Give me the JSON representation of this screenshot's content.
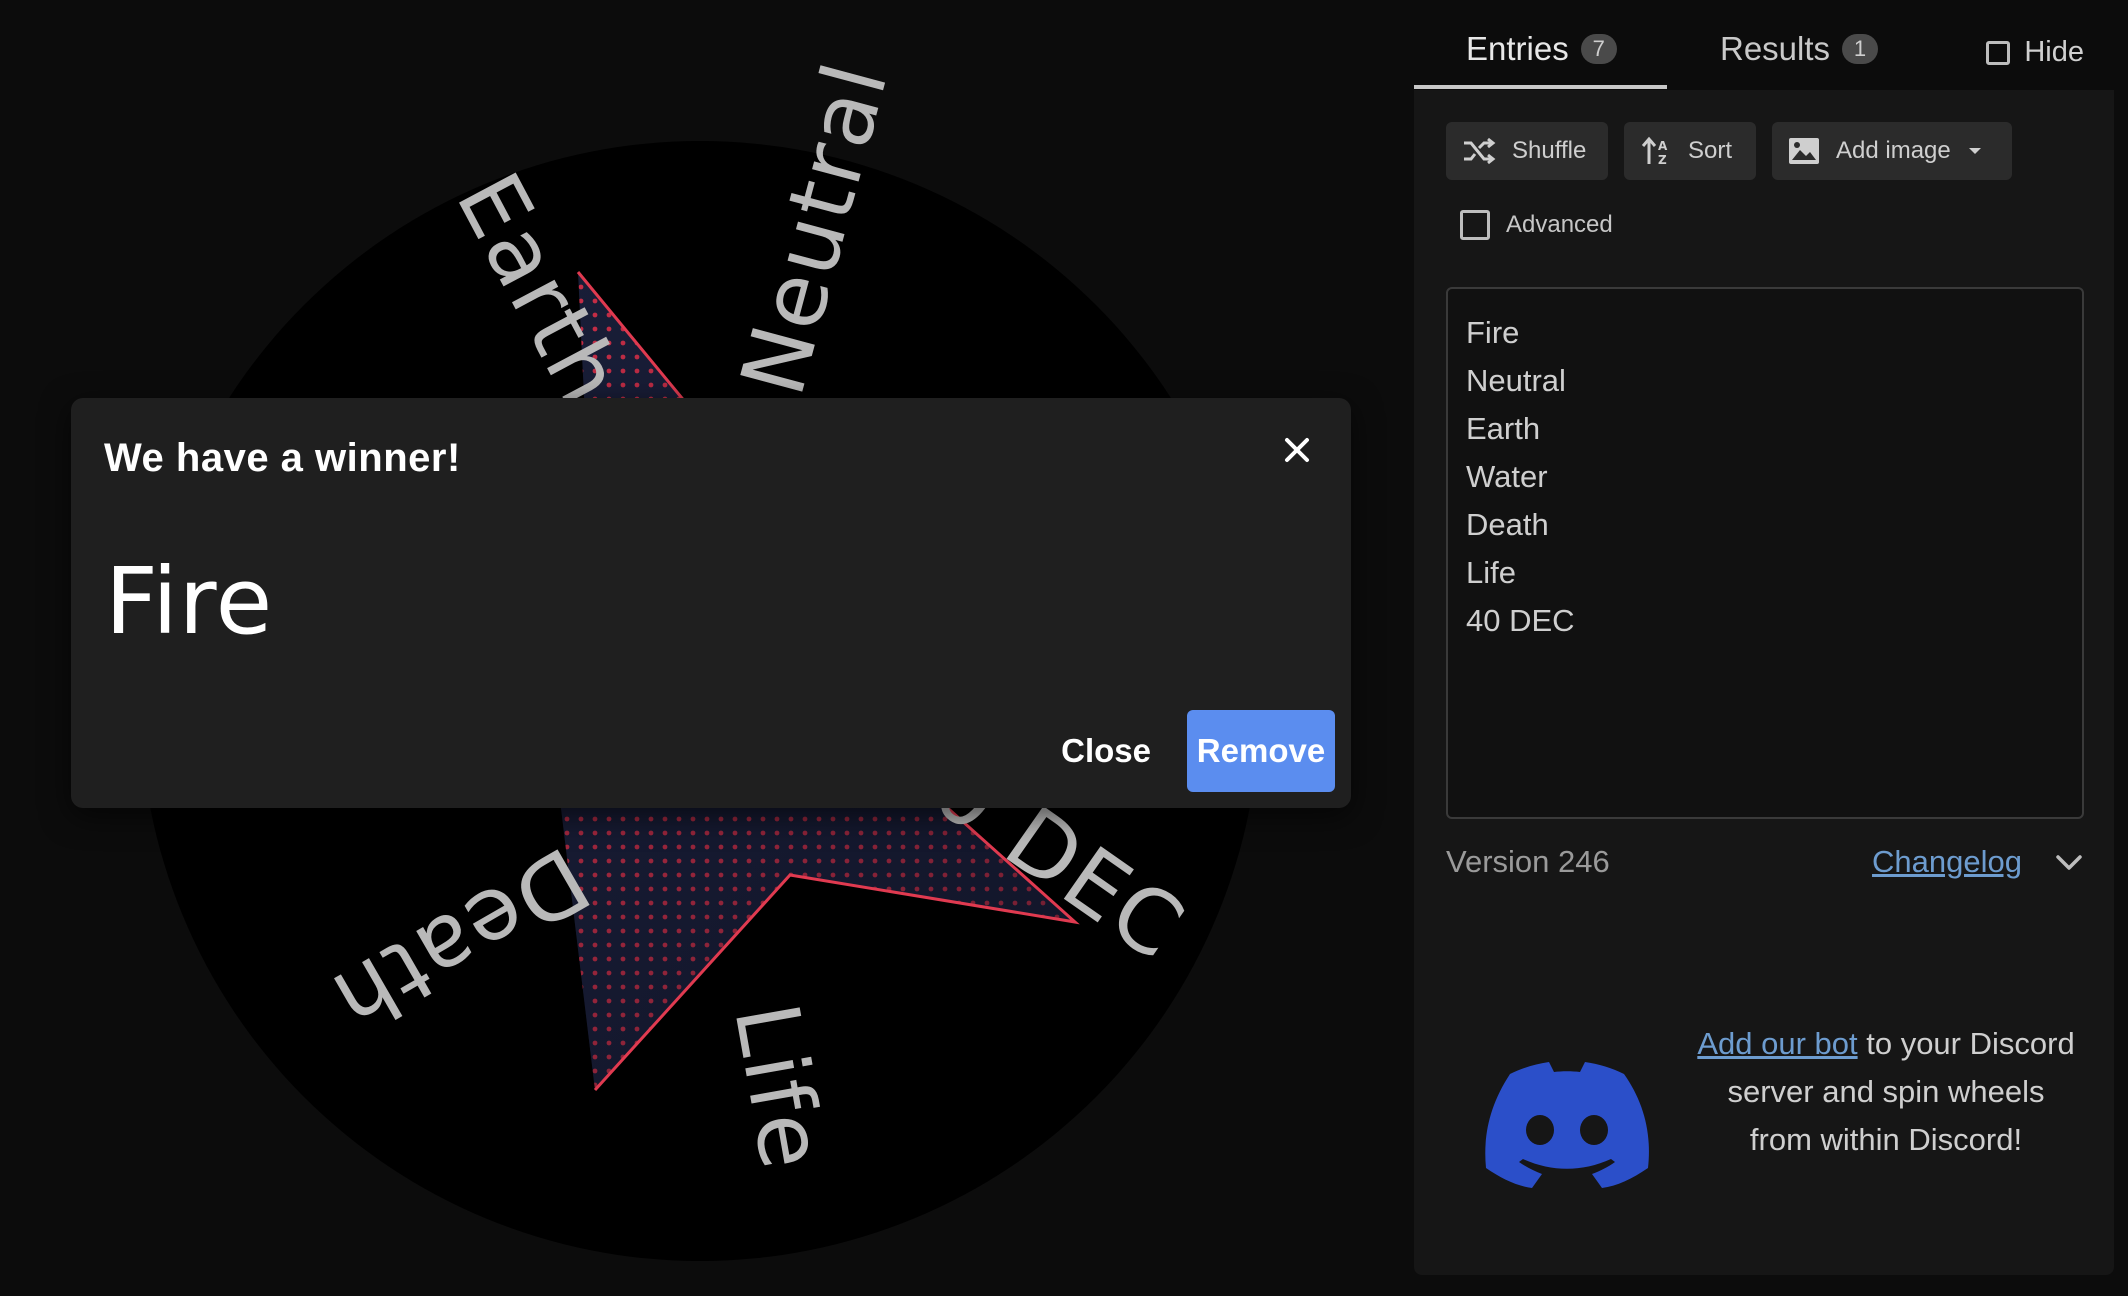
{
  "wheel": {
    "labels": [
      "Neutral",
      "Earth",
      "Death",
      "Life",
      "40 DEC",
      "Fire",
      "Water"
    ]
  },
  "modal": {
    "title": "We have a winner!",
    "winner": "Fire",
    "close_label": "Close",
    "remove_label": "Remove"
  },
  "tabs": {
    "entries_label": "Entries",
    "entries_count": "7",
    "results_label": "Results",
    "results_count": "1",
    "hide_label": "Hide"
  },
  "toolbar": {
    "shuffle_label": "Shuffle",
    "sort_label": "Sort",
    "add_image_label": "Add image",
    "advanced_label": "Advanced"
  },
  "entries": [
    "Fire",
    "Neutral",
    "Earth",
    "Water",
    "Death",
    "Life",
    "40 DEC"
  ],
  "footer": {
    "version": "Version 246",
    "changelog": "Changelog"
  },
  "discord": {
    "link_text": "Add our bot",
    "text_line1_rest": " to your Discord",
    "text_line2": "server and spin wheels",
    "text_line3": "from within Discord!"
  },
  "colors": {
    "accent": "#5b8def",
    "link": "#6d9ccf",
    "discord_blue": "#2b4fc9",
    "star_red": "#c8223c"
  }
}
